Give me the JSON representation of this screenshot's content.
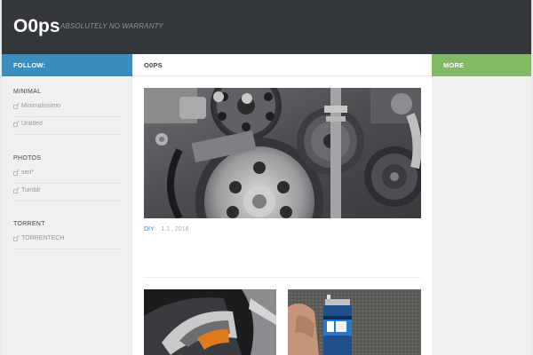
{
  "header": {
    "site_title": "O0ps",
    "tagline": "ABSOLUTELY NO WARRANTY"
  },
  "left_sidebar": {
    "follow_label": "FOLLOW:",
    "widgets": [
      {
        "title": "MINIMAL",
        "links": [
          "Minimalissimo",
          "Untitled"
        ]
      },
      {
        "title": "PHOTOS",
        "links": [
          "seri*",
          "Tumblr"
        ]
      },
      {
        "title": "TORRENT",
        "links": [
          "TORRENTECH"
        ]
      }
    ],
    "link_icon": "external-link-icon"
  },
  "main": {
    "section_label": "O0PS",
    "featured_post": {
      "image": "car-engine-belt-pulleys",
      "category": "DIY",
      "date": "1.1 , 2016"
    },
    "thumbnails": [
      {
        "image": "car-headlight"
      },
      {
        "image": "spray-can-on-carpet"
      }
    ]
  },
  "right_sidebar": {
    "more_label": "MORE"
  },
  "colors": {
    "header_bg": "#33363b",
    "follow_bar": "#3b8dbd",
    "more_bar": "#82b965",
    "category_link": "#3b8dbd"
  }
}
